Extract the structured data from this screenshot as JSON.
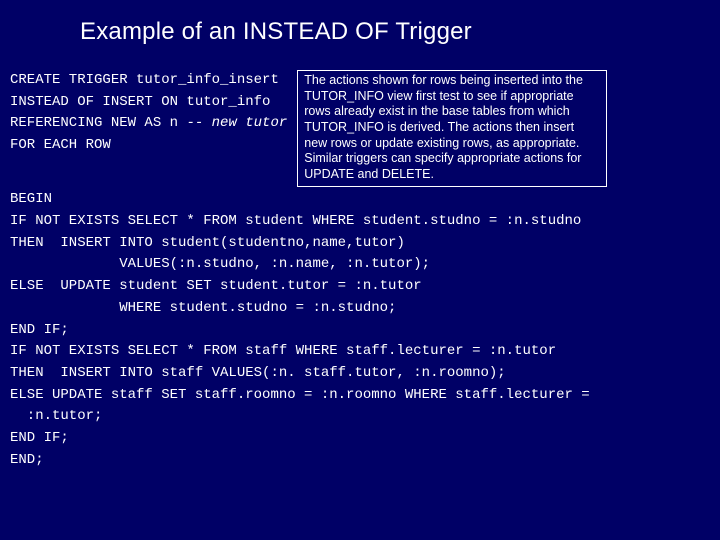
{
  "title": "Example of an INSTEAD OF Trigger",
  "code": {
    "l1": "CREATE TRIGGER tutor_info_insert",
    "l2": "INSTEAD OF INSERT ON tutor_info",
    "l3a": "REFERENCING NEW AS n ",
    "l3b": "-- new tutor",
    "l4": "FOR EACH ROW"
  },
  "explain": "The actions shown for rows being inserted into the TUTOR_INFO view first test to see if appropriate rows already exist in the base tables from which TUTOR_INFO is derived. The actions then insert new rows or update existing rows, as appropriate. Similar triggers can specify appropriate actions for UPDATE and DELETE.",
  "body": {
    "b1": "BEGIN",
    "b2": "IF NOT EXISTS SELECT * FROM student WHERE student.studno = :n.studno",
    "b3": "THEN  INSERT INTO student(studentno,name,tutor)",
    "b4": "             VALUES(:n.studno, :n.name, :n.tutor);",
    "b5": "ELSE  UPDATE student SET student.tutor = :n.tutor",
    "b6": "             WHERE student.studno = :n.studno;",
    "b7": "END IF;",
    "b8": "IF NOT EXISTS SELECT * FROM staff WHERE staff.lecturer = :n.tutor",
    "b9": "THEN  INSERT INTO staff VALUES(:n. staff.tutor, :n.roomno);",
    "b10": "ELSE UPDATE staff SET staff.roomno = :n.roomno WHERE staff.lecturer =",
    "b10b": "  :n.tutor;",
    "b11": "END IF;",
    "b12": "END;"
  }
}
